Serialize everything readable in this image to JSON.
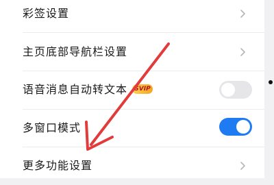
{
  "settings": {
    "rows": [
      {
        "label": "彩签设置"
      },
      {
        "label": "主页底部导航栏设置"
      },
      {
        "label": "语音消息自动转文本",
        "badge": "SVIP",
        "toggle_on": false
      },
      {
        "label": "多窗口模式",
        "toggle_on": true
      },
      {
        "label": "更多功能设置"
      }
    ]
  },
  "colors": {
    "toggle_on": "#1f7bf2",
    "toggle_off": "#e6e6e9",
    "annotation_arrow": "#e23b3b"
  },
  "icons": {
    "chevron": "chevron-right-icon",
    "arrow": "annotation-arrow",
    "dot": "edge-dot"
  }
}
